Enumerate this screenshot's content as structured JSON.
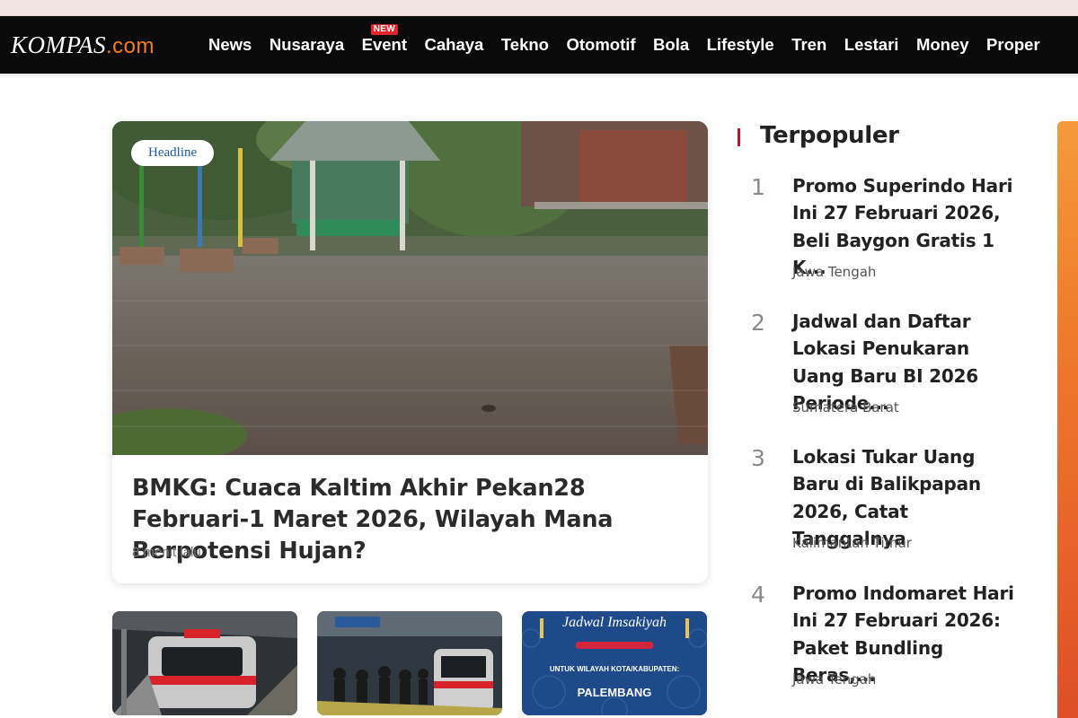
{
  "brand": {
    "name": "KOMPAS",
    "suffix": ".com"
  },
  "nav": {
    "items": [
      "News",
      "Nusaraya",
      "Event",
      "Cahaya",
      "Tekno",
      "Otomotif",
      "Bola",
      "Lifestyle",
      "Tren",
      "Lestari",
      "Money",
      "Proper"
    ],
    "new_badge": "NEW"
  },
  "headline": {
    "tag": "Headline",
    "title": "BMKG: Cuaca Kaltim Akhir Pekan28 Februari-1 Maret 2026, Wilayah Mana Berpotensi Hujan?",
    "time": "8 menit lalu"
  },
  "thumb3": {
    "title": "Jadwal Imsakiyah",
    "line1": "UNTUK WILAYAH KOTA/KABUPATEN:",
    "line2": "PALEMBANG"
  },
  "popular": {
    "title": "Terpopuler",
    "items": [
      {
        "num": "1",
        "title": "Promo Superindo Hari Ini 27 Februari 2026, Beli Baygon Gratis 1 K...",
        "region": "Jawa Tengah"
      },
      {
        "num": "2",
        "title": "Jadwal dan Daftar Lokasi Penukaran Uang Baru BI 2026 Periode...",
        "region": "Sumatera Barat"
      },
      {
        "num": "3",
        "title": "Lokasi Tukar Uang Baru di Balikpapan 2026, Catat Tanggalnya",
        "region": "Kalimantan Timur"
      },
      {
        "num": "4",
        "title": "Promo Indomaret Hari Ini 27 Februari 2026: Paket Bundling Beras,...",
        "region": "Jawa Tengah"
      }
    ]
  },
  "colors": {
    "accent": "#f47b20",
    "nav_bg": "#0a0a0a",
    "badge": "#e4252c",
    "section_bar": "#c8102e"
  }
}
